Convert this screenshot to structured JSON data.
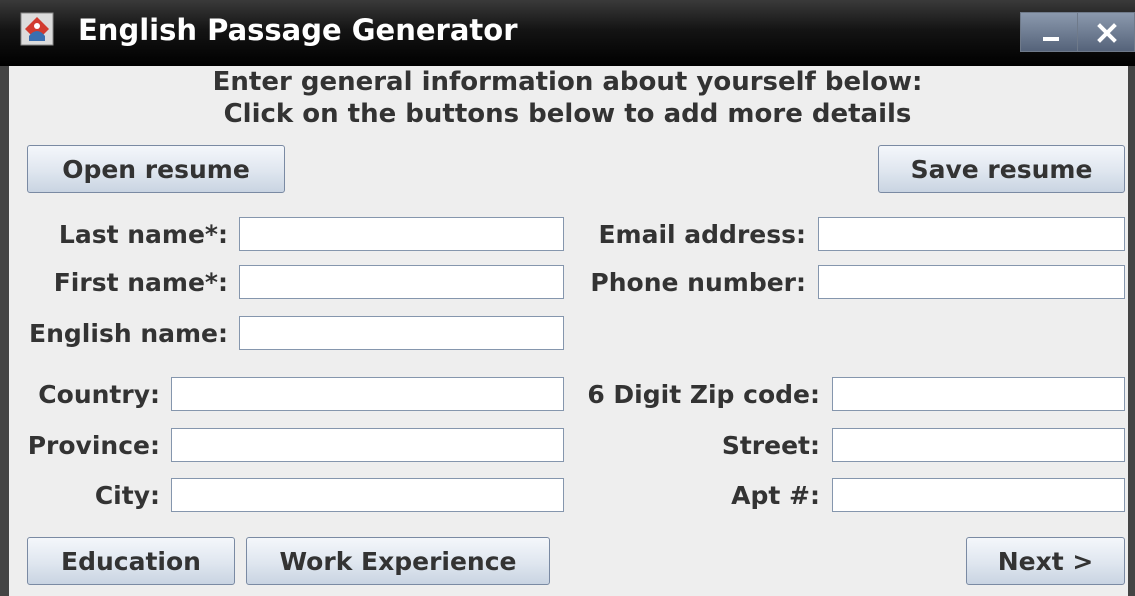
{
  "window": {
    "title": "English Passage Generator",
    "minimize_icon": "minimize-icon",
    "close_icon": "close-icon",
    "app_icon": "java-app-icon"
  },
  "header": {
    "line1": "Enter general information about yourself below:",
    "line2": "Click on the buttons below to add more details"
  },
  "toolbar": {
    "open_label": "Open resume",
    "save_label": "Save resume"
  },
  "personal": {
    "last_name_label": "Last name*:",
    "last_name_value": "",
    "first_name_label": "First name*:",
    "first_name_value": "",
    "english_name_label": "English name:",
    "english_name_value": "",
    "email_label": "Email address:",
    "email_value": "",
    "phone_label": "Phone number:",
    "phone_value": ""
  },
  "address": {
    "country_label": "Country:",
    "country_value": "",
    "province_label": "Province:",
    "province_value": "",
    "city_label": "City:",
    "city_value": "",
    "zip_label": "6 Digit Zip code:",
    "zip_value": "",
    "street_label": "Street:",
    "street_value": "",
    "apt_label": "Apt #:",
    "apt_value": ""
  },
  "footer": {
    "education_label": "Education",
    "work_label": "Work Experience",
    "next_label": "Next >"
  },
  "colors": {
    "window_bg": "#eeeeee",
    "titlebar": "#000000",
    "button_border": "#7a8aa3",
    "field_border": "#8596ad",
    "text": "#333333"
  }
}
